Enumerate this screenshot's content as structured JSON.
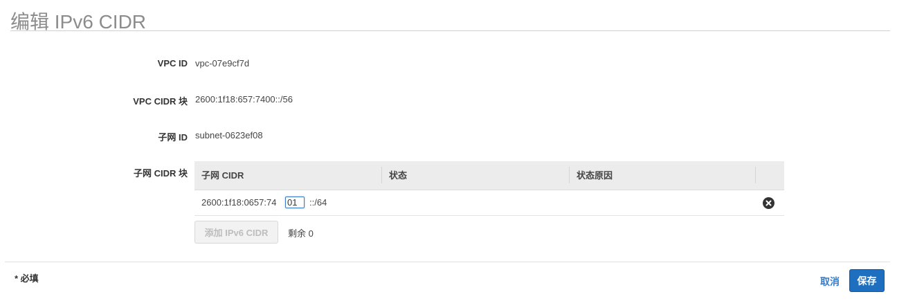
{
  "page": {
    "title": "编辑 IPv6 CIDR"
  },
  "fields": {
    "vpc_id_label": "VPC ID",
    "vpc_id_value": "vpc-07e9cf7d",
    "vpc_cidr_label": "VPC CIDR 块",
    "vpc_cidr_value": "2600:1f18:657:7400::/56",
    "subnet_id_label": "子网 ID",
    "subnet_id_value": "subnet-0623ef08",
    "subnet_cidr_label": "子网 CIDR 块"
  },
  "table": {
    "headers": [
      "子网 CIDR",
      "状态",
      "状态原因"
    ],
    "rows": [
      {
        "cidr_prefix": "2600:1f18:0657:74",
        "cidr_input_value": "01",
        "cidr_suffix": "::/64",
        "status": "",
        "status_reason": ""
      }
    ]
  },
  "actions": {
    "add_label": "添加 IPv6 CIDR",
    "remaining_text": "剩余 0"
  },
  "footer": {
    "required_note": "* 必填",
    "cancel_label": "取消",
    "save_label": "保存"
  },
  "colors": {
    "accent": "#1f6fc0",
    "link": "#3b7bc6"
  },
  "icons": {
    "remove": "close-circle-icon"
  }
}
